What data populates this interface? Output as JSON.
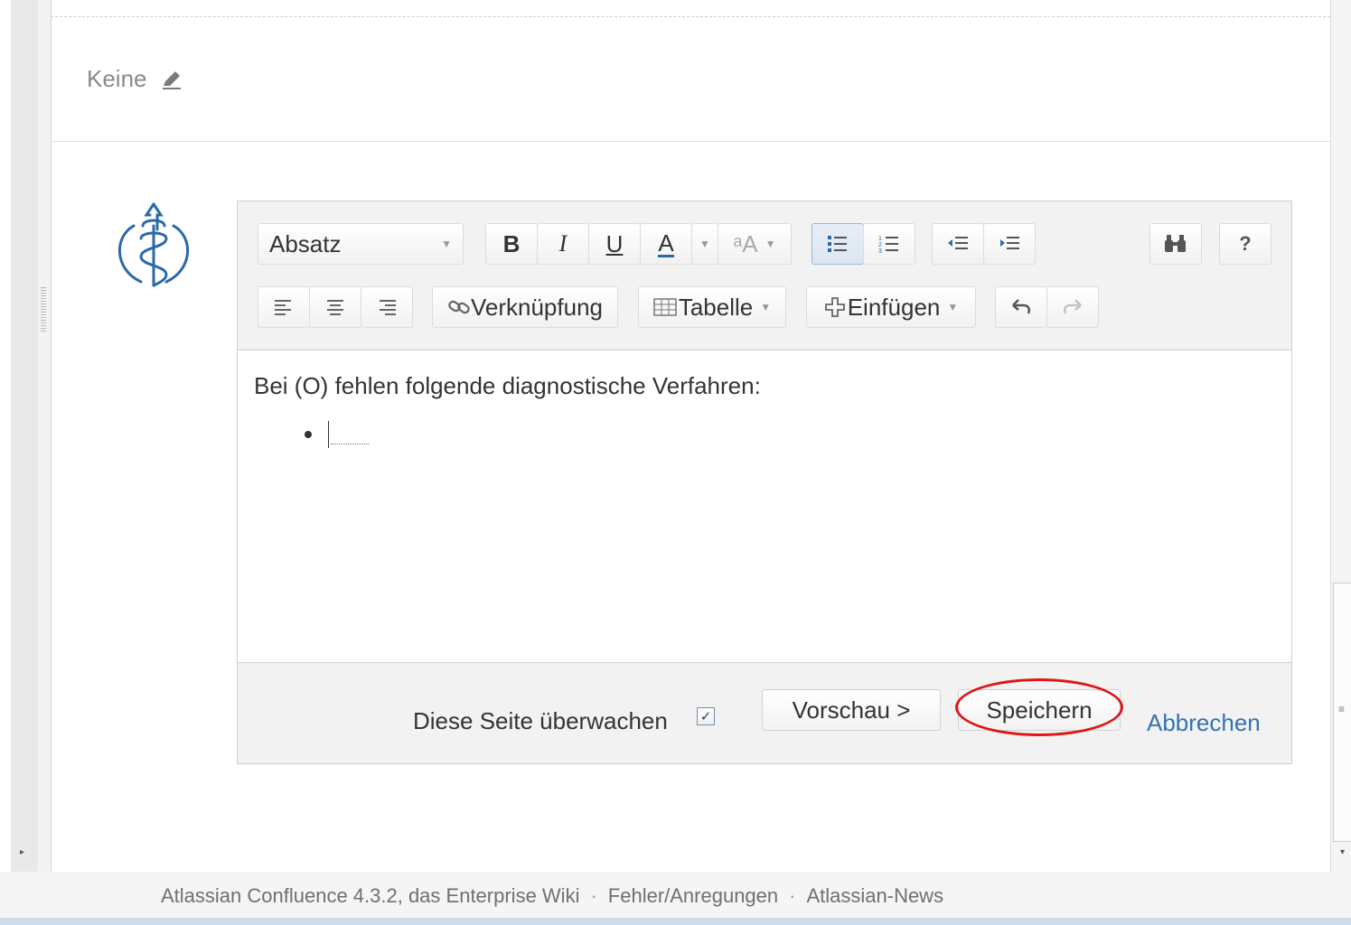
{
  "labels": {
    "value": "Keine"
  },
  "toolbar": {
    "paragraph_select": "Absatz",
    "bold": "B",
    "italic": "I",
    "underline": "U",
    "text_color": "A",
    "font_size": "ᵃA",
    "help": "?",
    "link_label": "Verknüpfung",
    "table_label": "Tabelle",
    "insert_label": "Einfügen"
  },
  "content": {
    "line": "Bei (O) fehlen folgende diagnostische Verfahren:"
  },
  "footer_bar": {
    "watch_label": "Diese Seite überwachen",
    "watch_checked": true,
    "preview_label": "Vorschau >",
    "save_label": "Speichern",
    "cancel_label": "Abbrechen"
  },
  "page_footer": {
    "product": "Atlassian Confluence 4.3.2, das Enterprise Wiki",
    "feedback": "Fehler/Anregungen",
    "news": "Atlassian-News",
    "separator": "·"
  },
  "colors": {
    "link": "#3572b0",
    "highlight": "#e01616",
    "logo": "#2a6aa8"
  },
  "icons": [
    "pencil-icon",
    "chevron-down-icon",
    "bullet-list-icon",
    "numbered-list-icon",
    "outdent-icon",
    "indent-icon",
    "find-replace-icon",
    "align-left-icon",
    "align-center-icon",
    "align-right-icon",
    "link-icon",
    "table-icon",
    "plus-icon",
    "undo-icon",
    "redo-icon",
    "checkbox-icon"
  ]
}
